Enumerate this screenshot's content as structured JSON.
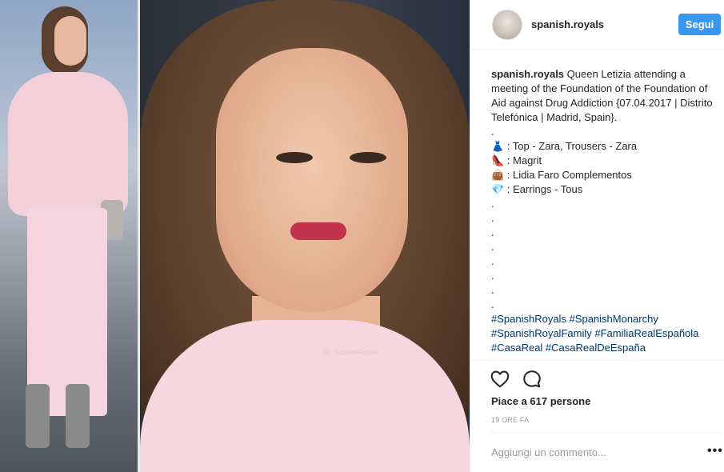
{
  "post": {
    "username": "spanish.royals",
    "follow_label": "Segui",
    "watermark": "IG: SpanishRoyals",
    "caption": {
      "username": "spanish.royals",
      "text": "Queen Letizia attending a meeting of the Foundation of the Foundation of Aid against Drug Addiction {07.04.2017 | Distrito Telefónica | Madrid, Spain}.",
      "items": [
        {
          "emoji": "👗",
          "text": " : Top - Zara, Trousers - Zara"
        },
        {
          "emoji": "👠",
          "text": " : Magrit"
        },
        {
          "emoji": "👜",
          "text": " : Lidia Faro Complementos"
        },
        {
          "emoji": "💎",
          "text": " : Earrings - Tous"
        }
      ],
      "dot": ".",
      "hashtags_line1": "#SpanishRoyals #SpanishMonarchy",
      "hashtags_line2": "#SpanishRoyalFamily #FamiliaRealEspañola",
      "hashtags_line3": "#CasaReal #CasaRealDeEspaña"
    },
    "likes_text": "Piace a 617 persone",
    "time_text": "19 ORE FA",
    "comment_placeholder": "Aggiungi un commento...",
    "more_label": "•••"
  },
  "icons": {
    "like": "heart-icon",
    "comment": "comment-icon"
  },
  "colors": {
    "follow_button": "#3897f0",
    "hashtag": "#003569",
    "muted": "#999999"
  }
}
